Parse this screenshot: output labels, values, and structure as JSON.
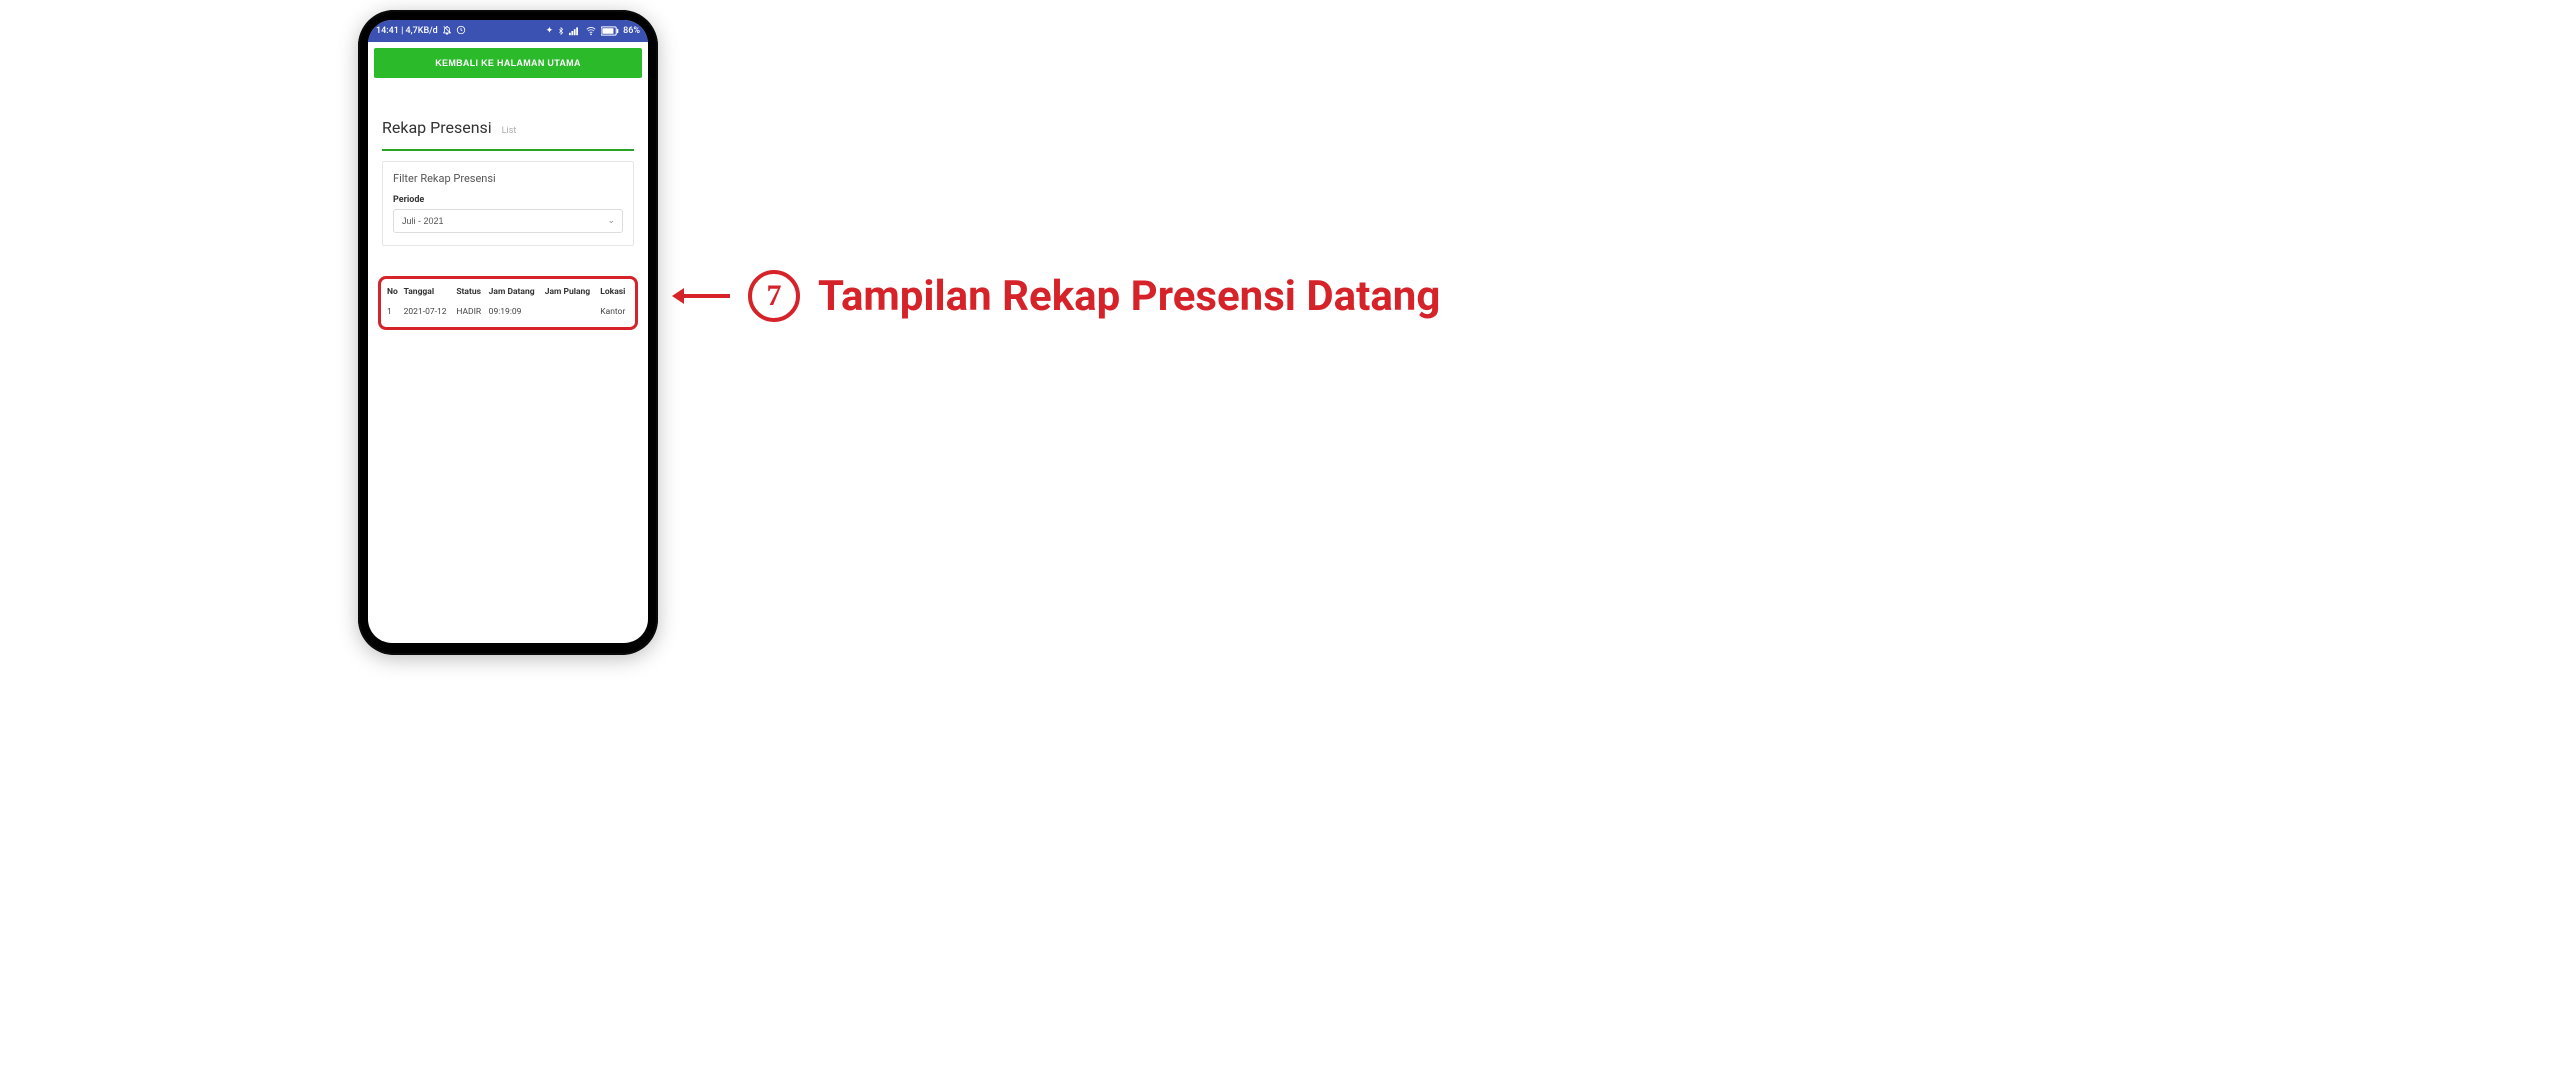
{
  "statusbar": {
    "left": "14:41 | 4,7KB/d",
    "battery_pct": "86%"
  },
  "top_button_label": "KEMBALI KE HALAMAN UTAMA",
  "page_title": "Rekap Presensi",
  "page_subtitle": "List",
  "filter": {
    "card_title": "Filter Rekap Presensi",
    "periode_label": "Periode",
    "periode_value": "Juli - 2021"
  },
  "table": {
    "headers": {
      "no": "No",
      "tanggal": "Tanggal",
      "status": "Status",
      "jam_datang": "Jam Datang",
      "jam_pulang": "Jam Pulang",
      "lokasi": "Lokasi"
    },
    "rows": [
      {
        "no": "1",
        "tanggal": "2021-07-12",
        "status": "HADIR",
        "jam_datang": "09:19:09",
        "jam_pulang": "",
        "lokasi": "Kantor"
      }
    ]
  },
  "annotation": {
    "number": "7",
    "text": "Tampilan Rekap Presensi Datang"
  }
}
